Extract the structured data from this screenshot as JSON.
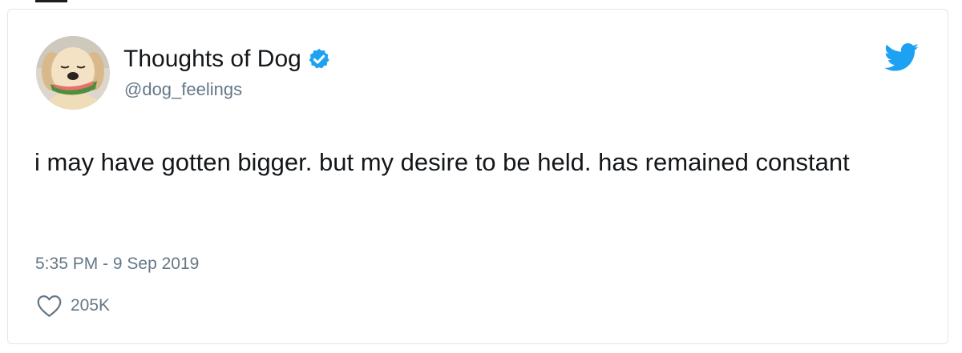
{
  "tweet": {
    "display_name": "Thoughts of Dog",
    "handle": "@dog_feelings",
    "verified": true,
    "text": "i may have gotten bigger. but my desire to be held. has remained constant",
    "timestamp": "5:35 PM - 9 Sep 2019",
    "likes": "205K"
  },
  "icons": {
    "verified": "verified-badge-icon",
    "brand": "twitter-bird-icon",
    "like": "heart-outline-icon"
  },
  "colors": {
    "brand_blue": "#1da1f2",
    "secondary_text": "#657786",
    "primary_text": "#14171a",
    "border": "#e1e8ed"
  }
}
